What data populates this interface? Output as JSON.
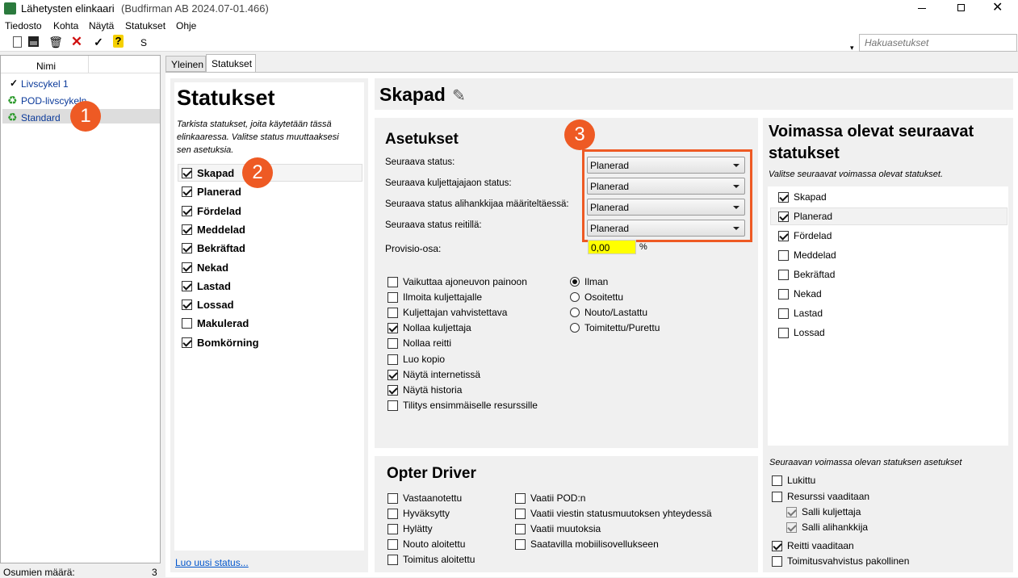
{
  "window": {
    "title": "Lähetysten elinkaari",
    "subtitle": "(Budfirman AB 2024.07-01.466)"
  },
  "menu": [
    "Tiedosto",
    "Kohta",
    "Näytä",
    "Statukset",
    "Ohje"
  ],
  "toolbar": {
    "s_label": "S",
    "search_placeholder": "Hakuasetukset"
  },
  "left": {
    "column_header": "Nimi",
    "items": [
      {
        "label": "Livscykel 1"
      },
      {
        "label": "POD-livscykeln"
      },
      {
        "label": "Standard"
      }
    ],
    "count_label": "Osumien määrä:",
    "count_value": "3"
  },
  "tabs": [
    "Yleinen",
    "Statukset"
  ],
  "statuses_panel": {
    "title": "Statukset",
    "description": "Tarkista statukset, joita käytetään tässä elinkaaressa. Valitse status muuttaaksesi sen asetuksia.",
    "items": [
      {
        "label": "Skapad",
        "checked": true
      },
      {
        "label": "Planerad",
        "checked": true
      },
      {
        "label": "Fördelad",
        "checked": true
      },
      {
        "label": "Meddelad",
        "checked": true
      },
      {
        "label": "Bekräftad",
        "checked": true
      },
      {
        "label": "Nekad",
        "checked": true
      },
      {
        "label": "Lastad",
        "checked": true
      },
      {
        "label": "Lossad",
        "checked": true
      },
      {
        "label": "Makulerad",
        "checked": false
      },
      {
        "label": "Bomkörning",
        "checked": true
      }
    ],
    "new_link": "Luo uusi status..."
  },
  "detail": {
    "title": "Skapad"
  },
  "settings": {
    "title": "Asetukset",
    "fields": [
      {
        "label": "Seuraava status:",
        "value": "Planerad"
      },
      {
        "label": "Seuraava kuljettajajaon status:",
        "value": "Planerad"
      },
      {
        "label": "Seuraava status alihankkijaa määriteltäessä:",
        "value": "Planerad"
      },
      {
        "label": "Seuraava status reitillä:",
        "value": "Planerad"
      }
    ],
    "provision_label": "Provisio-osa:",
    "provision_value": "0,00",
    "provision_unit": "%",
    "checks": [
      {
        "label": "Vaikuttaa ajoneuvon painoon",
        "checked": false
      },
      {
        "label": "Ilmoita kuljettajalle",
        "checked": false
      },
      {
        "label": "Kuljettajan vahvistettava",
        "checked": false
      },
      {
        "label": "Nollaa kuljettaja",
        "checked": true
      },
      {
        "label": "Nollaa reitti",
        "checked": false
      },
      {
        "label": "Luo kopio",
        "checked": false
      },
      {
        "label": "Näytä internetissä",
        "checked": true
      },
      {
        "label": "Näytä historia",
        "checked": true
      },
      {
        "label": "Tilitys ensimmäiselle resurssille",
        "checked": false
      }
    ],
    "radios": [
      {
        "label": "Ilman",
        "checked": true
      },
      {
        "label": "Osoitettu",
        "checked": false
      },
      {
        "label": "Nouto/Lastattu",
        "checked": false
      },
      {
        "label": "Toimitettu/Purettu",
        "checked": false
      }
    ]
  },
  "driver": {
    "title": "Opter Driver",
    "col1": [
      {
        "label": "Vastaanotettu",
        "checked": false
      },
      {
        "label": "Hyväksytty",
        "checked": false
      },
      {
        "label": "Hylätty",
        "checked": false
      },
      {
        "label": "Nouto aloitettu",
        "checked": false
      },
      {
        "label": "Toimitus aloitettu",
        "checked": false
      }
    ],
    "col2": [
      {
        "label": "Vaatii POD:n",
        "checked": false
      },
      {
        "label": "Vaatii viestin statusmuutoksen yhteydessä",
        "checked": false
      },
      {
        "label": "Vaatii muutoksia",
        "checked": false
      },
      {
        "label": "Saatavilla mobiilisovellukseen",
        "checked": false
      }
    ]
  },
  "next": {
    "title_line1": "Voimassa olevat seuraavat",
    "title_line2": "statukset",
    "description": "Valitse seuraavat voimassa olevat statukset.",
    "items": [
      {
        "label": "Skapad",
        "checked": true
      },
      {
        "label": "Planerad",
        "checked": true
      },
      {
        "label": "Fördelad",
        "checked": true
      },
      {
        "label": "Meddelad",
        "checked": false
      },
      {
        "label": "Bekräftad",
        "checked": false
      },
      {
        "label": "Nekad",
        "checked": false
      },
      {
        "label": "Lastad",
        "checked": false
      },
      {
        "label": "Lossad",
        "checked": false
      }
    ],
    "settings_title": "Seuraavan voimassa olevan statuksen asetukset",
    "settings": [
      {
        "label": "Lukittu",
        "checked": false
      },
      {
        "label": "Resurssi vaaditaan",
        "checked": false
      },
      {
        "label": "Salli kuljettaja",
        "checked": true
      },
      {
        "label": "Salli alihankkija",
        "checked": true
      },
      {
        "label": "Reitti vaaditaan",
        "checked": true
      },
      {
        "label": "Toimitusvahvistus pakollinen",
        "checked": false
      }
    ]
  },
  "annotations": [
    "1",
    "2",
    "3"
  ],
  "colors": {
    "accent": "#ee5a24",
    "highlight_field": "#ffff00",
    "link": "#0055cc"
  }
}
